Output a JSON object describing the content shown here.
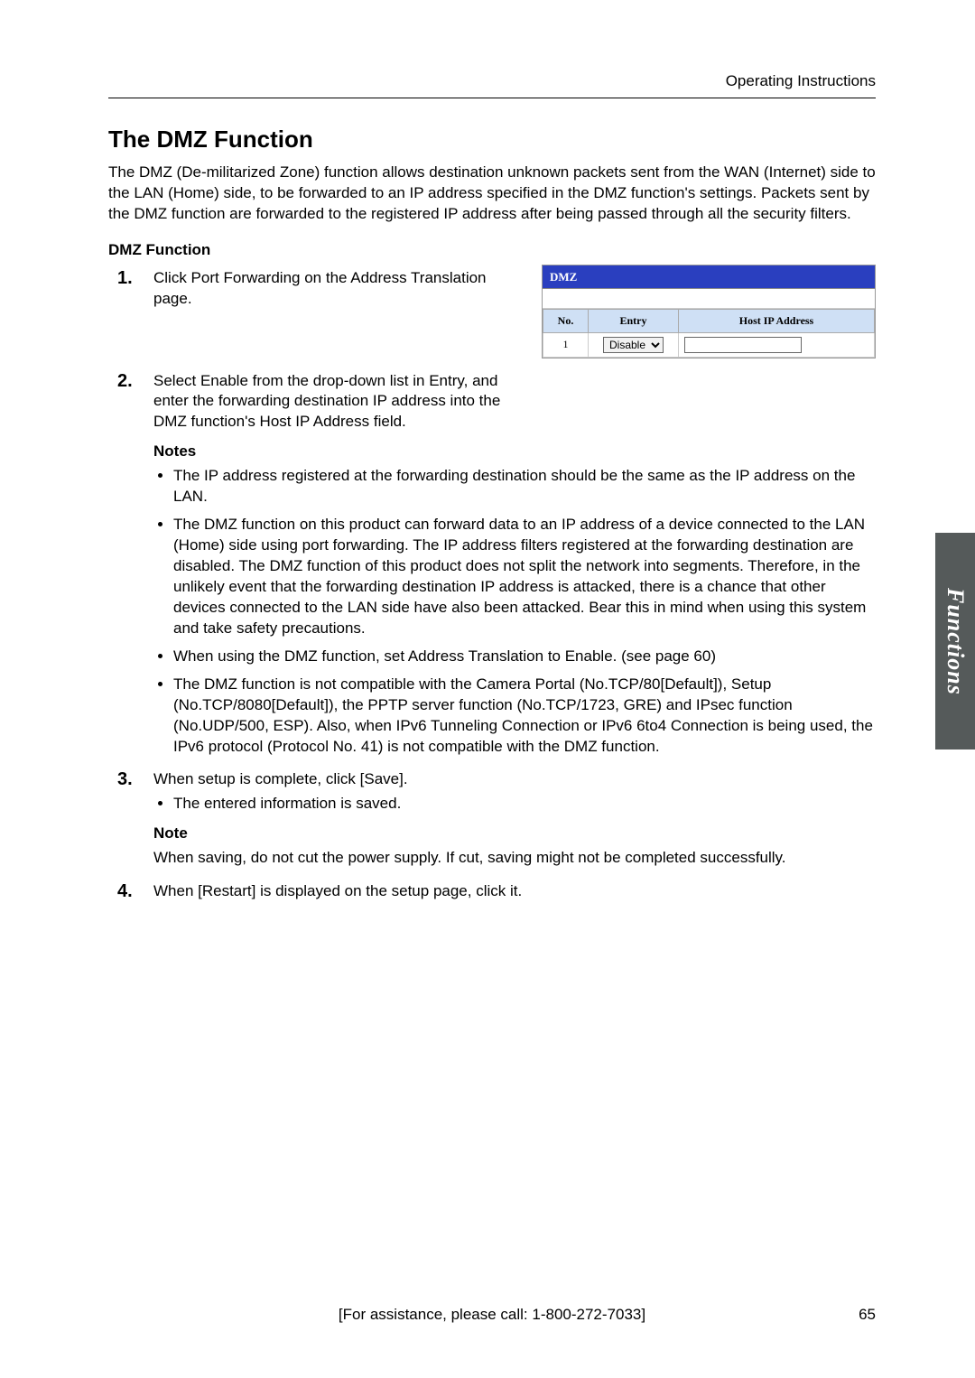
{
  "header": {
    "doc_title": "Operating Instructions"
  },
  "section": {
    "title": "The DMZ Function",
    "intro": "The DMZ (De-militarized Zone) function allows destination unknown packets sent from the WAN (Internet) side to the LAN (Home) side, to be forwarded to an IP address specified in the DMZ function's settings. Packets sent by the DMZ function are forwarded to the registered IP address after being passed through all the security filters.",
    "subhead": "DMZ Function"
  },
  "steps": {
    "s1": "Click Port Forwarding on the Address Translation page.",
    "s2": "Select Enable from the drop-down list in Entry, and enter the forwarding destination IP address into the DMZ function's Host IP Address field.",
    "s2_notes_head": "Notes",
    "s2_notes": [
      "The IP address registered at the forwarding destination should be the same as the IP address on the LAN.",
      "The DMZ function on this product can forward data to an IP address of a device connected to the LAN (Home) side using port forwarding. The IP address filters registered at the forwarding destination are disabled. The DMZ function of this product does not split the network into segments. Therefore, in the unlikely event that the forwarding destination IP address is attacked, there is a chance that other devices connected to the LAN side have also been attacked. Bear this in mind when using this system and take safety precautions.",
      "When using the DMZ function, set Address Translation to Enable. (see page 60)",
      "The DMZ function is not compatible with the Camera Portal (No.TCP/80[Default]), Setup (No.TCP/8080[Default]), the PPTP server function (No.TCP/1723, GRE) and IPsec function (No.UDP/500, ESP). Also, when IPv6 Tunneling Connection or IPv6 6to4 Connection is being used, the IPv6 protocol (Protocol No. 41) is not compatible with the DMZ function."
    ],
    "s3": "When setup is complete, click [Save].",
    "s3_bullet": "The entered information is saved.",
    "s3_note_head": "Note",
    "s3_note": "When saving, do not cut the power supply. If cut, saving might not be completed successfully.",
    "s4": "When [Restart] is displayed on the setup page, click it."
  },
  "dmz_widget": {
    "title": "DMZ",
    "cols": {
      "no": "No.",
      "entry": "Entry",
      "host": "Host IP Address"
    },
    "row": {
      "no": "1",
      "entry_value": "Disable",
      "host_value": ""
    }
  },
  "side_tab": "Functions",
  "footer": {
    "assist": "[For assistance, please call: 1-800-272-7033]",
    "page": "65"
  }
}
